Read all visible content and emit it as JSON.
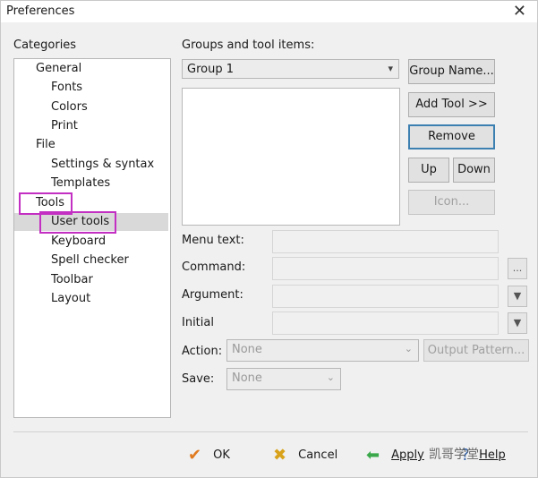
{
  "window": {
    "title": "Preferences",
    "close_glyph": "✕"
  },
  "categories": {
    "label": "Categories",
    "items": [
      {
        "label": "General"
      },
      {
        "label": "Fonts"
      },
      {
        "label": "Colors"
      },
      {
        "label": "Print"
      },
      {
        "label": "File"
      },
      {
        "label": "Settings & syntax"
      },
      {
        "label": "Templates"
      },
      {
        "label": "Tools"
      },
      {
        "label": "User tools",
        "selected": true
      },
      {
        "label": "Keyboard"
      },
      {
        "label": "Spell checker"
      },
      {
        "label": "Toolbar"
      },
      {
        "label": "Layout"
      }
    ]
  },
  "groups": {
    "label": "Groups and tool items:",
    "selected": "Group 1",
    "group_name_button": "Group Name...",
    "add_tool_button": "Add Tool >>",
    "remove_button": "Remove",
    "up_button": "Up",
    "down_button": "Down",
    "icon_button": "Icon..."
  },
  "form": {
    "menu_text_label": "Menu text:",
    "command_label": "Command:",
    "command_browse": "...",
    "argument_label": "Argument:",
    "initial_label": "Initial",
    "action_label": "Action:",
    "action_value": "None",
    "output_pattern_button": "Output Pattern...",
    "save_label": "Save:",
    "save_value": "None"
  },
  "footer": {
    "ok": "OK",
    "cancel": "Cancel",
    "apply": "Apply",
    "help": "Help",
    "watermark": "凯哥学堂"
  },
  "colors": {
    "highlight": "#c22fc2",
    "focus": "#3c7fb1",
    "ok_icon": "#e07a1f",
    "cancel_icon": "#d9a21b",
    "apply_icon": "#3aa84a"
  }
}
